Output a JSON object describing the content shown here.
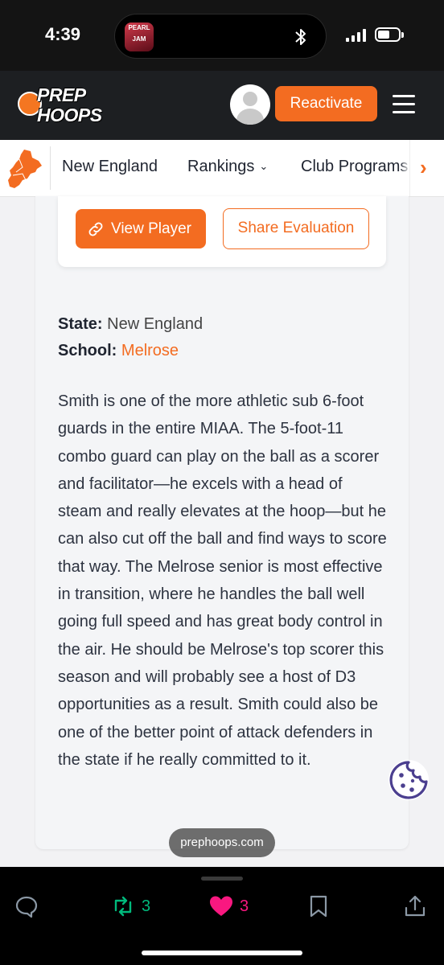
{
  "status_bar": {
    "time": "4:39",
    "now_playing_art_text": "PEARL JAM"
  },
  "header": {
    "logo_line1": "PREP",
    "logo_line2": "HOOPS",
    "reactivate_label": "Reactivate"
  },
  "nav": {
    "items": [
      {
        "label": "New England"
      },
      {
        "label": "Rankings"
      },
      {
        "label": "Club Programs"
      }
    ],
    "rankings_chevron": "⌄",
    "next_arrow": "›"
  },
  "card": {
    "view_player_label": "View Player",
    "share_label": "Share Evaluation"
  },
  "player": {
    "state_label": "State:",
    "state_value": "New England",
    "school_label": "School:",
    "school_value": "Melrose"
  },
  "evaluation": "Smith is one of the more athletic sub 6-foot guards in the entire MIAA. The 5-foot-11 combo guard can play on the ball as a scorer and facilitator—he excels with a head of steam and really elevates at the hoop—but he can also cut off the ball and find ways to score that way. The Melrose senior is most effective in transition, where he handles the ball well going full speed and has great body control in the air. He should be Melrose's top scorer this season and will probably see a host of D3 opportunities as a result. Smith could also be one of the better point of attack defenders in the state if he really committed to it.",
  "watermark": "prephoops.com",
  "bottom_bar": {
    "repost_count": "3",
    "like_count": "3"
  },
  "colors": {
    "accent": "#f36c21",
    "header_bg": "#1d1f22",
    "repost_green": "#00ba7c",
    "like_pink": "#f91880",
    "cookie_purple": "#4b3f8f"
  },
  "icons": [
    "link-icon",
    "user-avatar-icon",
    "menu-icon",
    "new-england-map-icon",
    "chevron-right-icon",
    "cookie-icon",
    "reply-icon",
    "repost-icon",
    "heart-icon",
    "bookmark-icon",
    "share-icon",
    "bluetooth-icon",
    "signal-icon",
    "battery-icon"
  ]
}
